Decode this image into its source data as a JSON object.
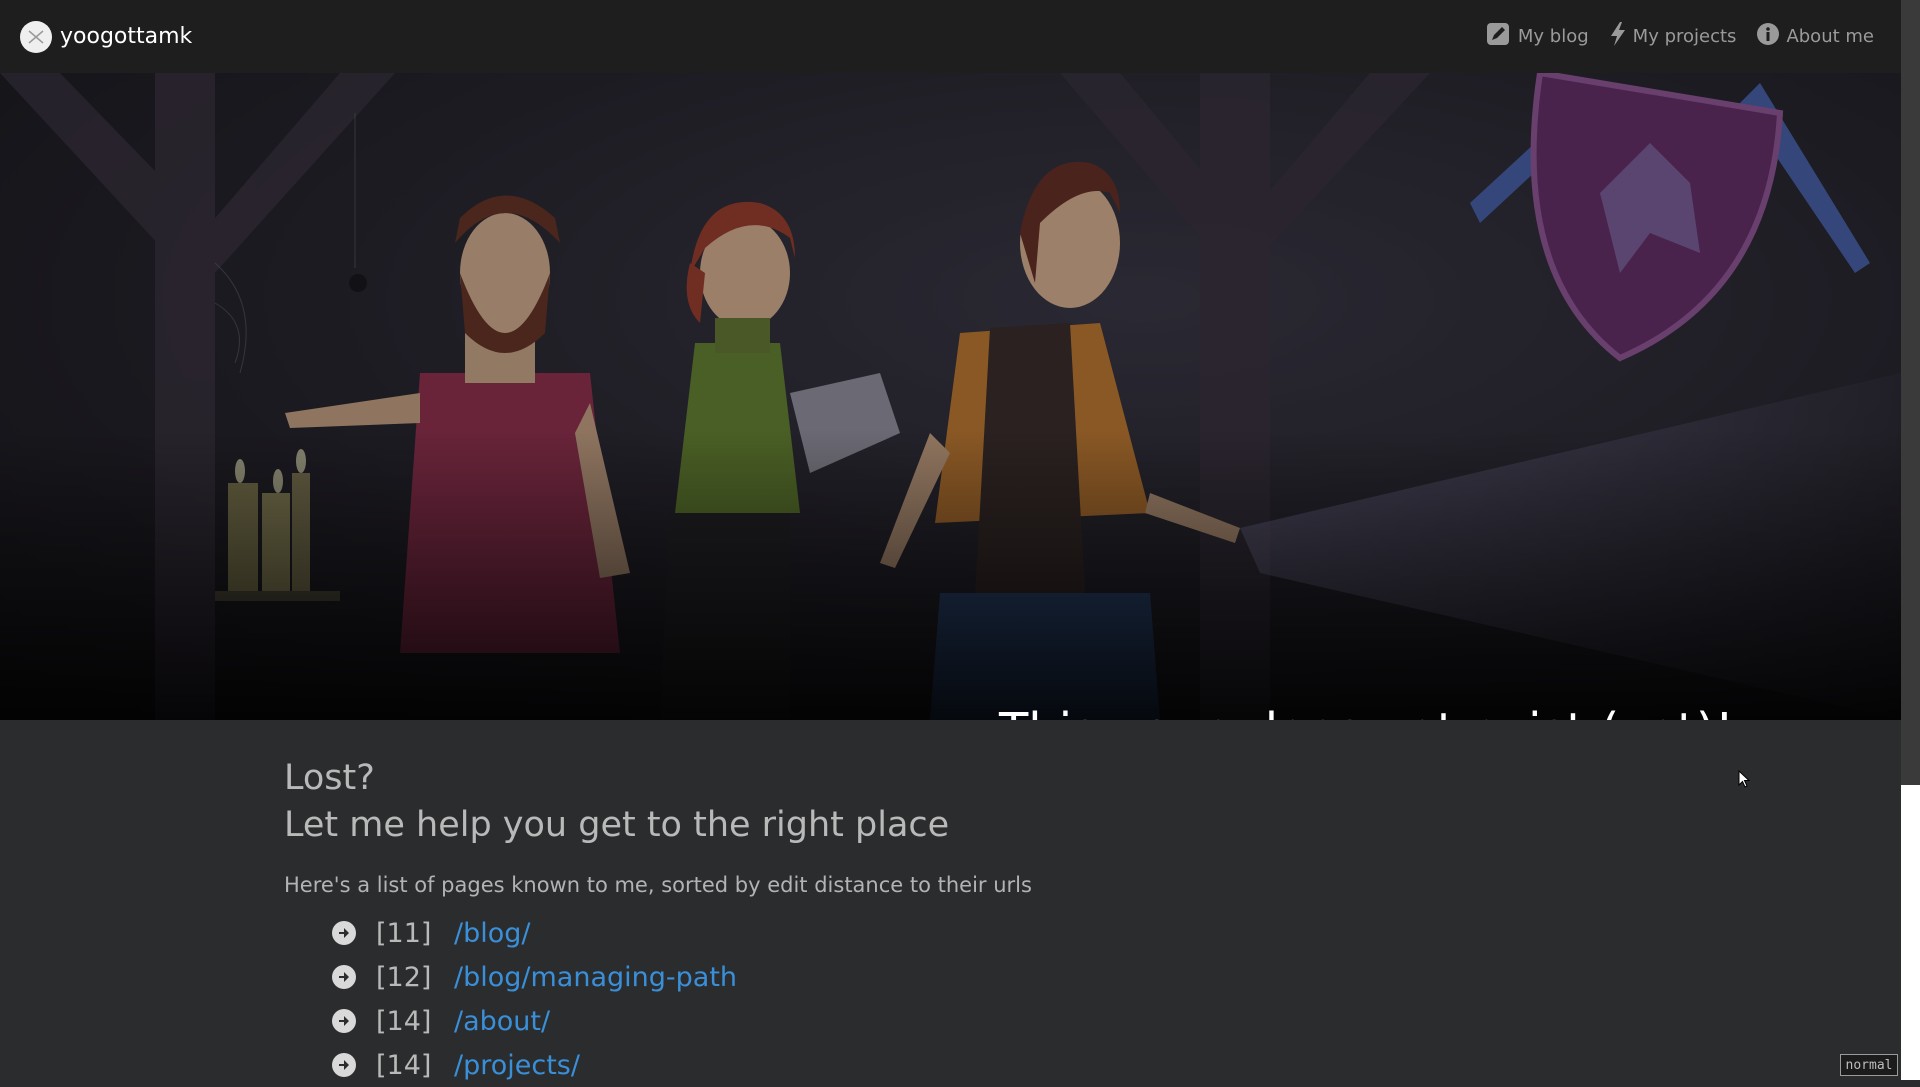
{
  "nav": {
    "brand": "yoogottamk",
    "links": [
      {
        "label": "My blog",
        "icon": "pencil-icon"
      },
      {
        "label": "My projects",
        "icon": "lightning-icon"
      },
      {
        "label": "About me",
        "icon": "info-icon"
      }
    ]
  },
  "hero": {
    "title": "This page does not exist (yet)!"
  },
  "content": {
    "title": "Lost?",
    "subtitle": "Let me help you get to the right place",
    "intro": "Here's a list of pages known to me, sorted by edit distance to their urls",
    "pages": [
      {
        "distance": "[11]",
        "url": "/blog/"
      },
      {
        "distance": "[12]",
        "url": "/blog/managing-path"
      },
      {
        "distance": "[14]",
        "url": "/about/"
      },
      {
        "distance": "[14]",
        "url": "/projects/"
      }
    ]
  },
  "status": {
    "mode": "normal"
  },
  "colors": {
    "background": "#2b2c2d",
    "navbar": "#1e1e1f",
    "link": "#3a8fd9"
  }
}
